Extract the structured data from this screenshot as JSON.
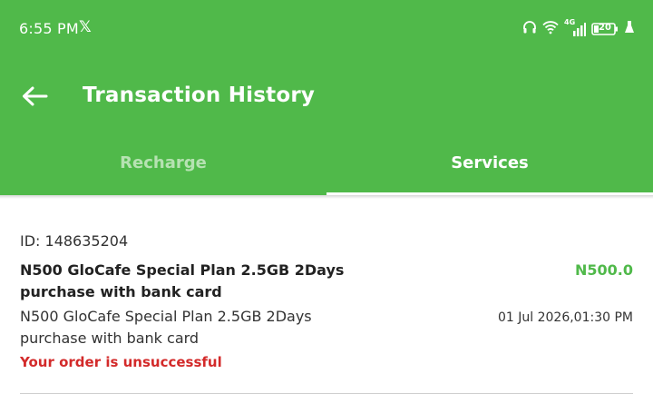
{
  "status_bar": {
    "time": "6:55 PM",
    "app_icon": "x-logo-icon",
    "network": "4G",
    "battery": "20"
  },
  "header": {
    "title": "Transaction History",
    "back_icon": "arrow-left-icon",
    "background_color": "#50b94a"
  },
  "tabs": [
    {
      "label": "Recharge",
      "selected": false
    },
    {
      "label": "Services",
      "selected": true
    }
  ],
  "transactions": [
    {
      "id_text": "ID: 148635204",
      "title": "N500 GloCafe Special Plan 2.5GB 2Days purchase with bank card",
      "amount": "N500.0",
      "description": "N500 GloCafe Special Plan 2.5GB 2Days purchase with bank card",
      "date": "01 Jul 2026,01:30 PM",
      "status": "Your order is unsuccessful",
      "status_color": "#d32a2a",
      "amount_color": "#50b94a"
    }
  ]
}
